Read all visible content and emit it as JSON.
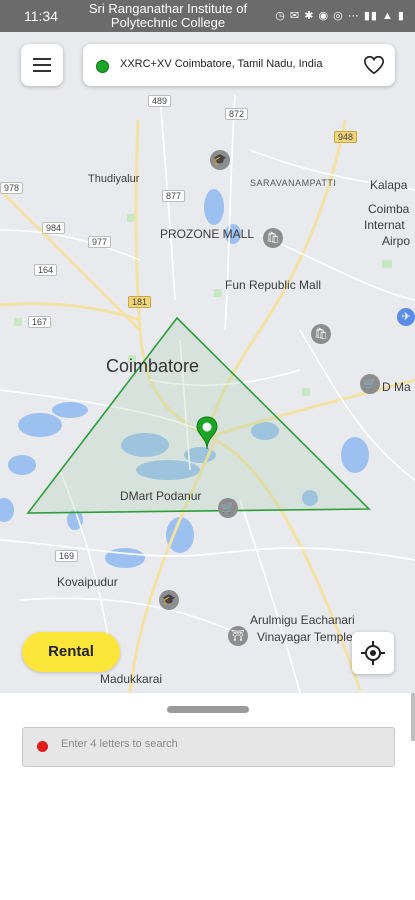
{
  "status_bar": {
    "time": "11:34",
    "banner": "Sri Ranganathar Institute of Polytechnic College",
    "icons_text": "◷ ✉ ✱ ◉ ◎ ⋯ ▮▮ ▲ ▮"
  },
  "header": {
    "menu_icon": "hamburger-menu-icon",
    "location_text": "XXRC+XV Coimbatore, Tamil Nadu, India",
    "favorite_icon": "heart-outline-icon"
  },
  "map": {
    "labels": {
      "thudiyalur": "Thudiyalur",
      "saravanampatti": "SARAVANAMPATTI",
      "kalapatti": "Kalapa",
      "coimbatore_intl": "Coimba",
      "coimbatore_intl2": "Internat",
      "coimbatore_intl3": "Airpo",
      "prozone": "PROZONE MALL",
      "fun_republic": "Fun Republic Mall",
      "coimbatore": "Coimbatore",
      "dmart_small": "D Ma",
      "dmart_podanur": "DMart Podanur",
      "kovaipudur": "Kovaipudur",
      "arulmigu": "Arulmigu Eachanari",
      "vinayagar": "Vinayagar Temple",
      "madukkarai": "Madukkarai"
    },
    "route_numbers": {
      "r489": "489",
      "r872": "872",
      "r948": "948",
      "r877": "877",
      "r984": "984",
      "r977": "977",
      "r978": "978",
      "r164": "164",
      "r181": "181",
      "r167": "167",
      "r169": "169"
    }
  },
  "rental_button": "Rental",
  "locate_icon": "my-location-icon",
  "bottom_sheet": {
    "search_placeholder": "Enter 4 letters to search",
    "search_value": ""
  },
  "colors": {
    "accent_yellow": "#FDE63A",
    "marker_green": "#1AA526",
    "polygon_green": "#2E9E3A",
    "search_dot_red": "#E21B1B"
  }
}
